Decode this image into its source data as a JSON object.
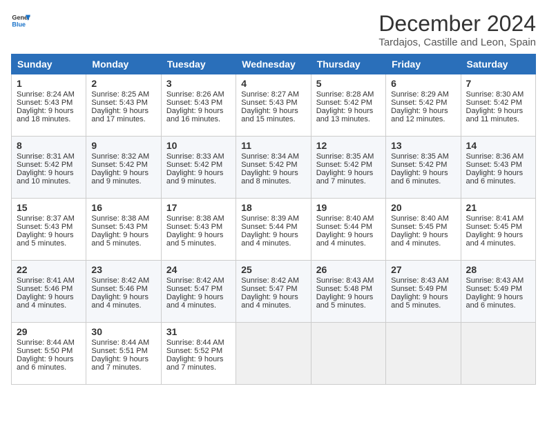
{
  "logo": {
    "line1": "General",
    "line2": "Blue"
  },
  "title": "December 2024",
  "location": "Tardajos, Castille and Leon, Spain",
  "headers": [
    "Sunday",
    "Monday",
    "Tuesday",
    "Wednesday",
    "Thursday",
    "Friday",
    "Saturday"
  ],
  "weeks": [
    [
      {
        "day": "1",
        "sunrise": "8:24 AM",
        "sunset": "5:43 PM",
        "daylight": "9 hours and 18 minutes."
      },
      {
        "day": "2",
        "sunrise": "8:25 AM",
        "sunset": "5:43 PM",
        "daylight": "9 hours and 17 minutes."
      },
      {
        "day": "3",
        "sunrise": "8:26 AM",
        "sunset": "5:43 PM",
        "daylight": "9 hours and 16 minutes."
      },
      {
        "day": "4",
        "sunrise": "8:27 AM",
        "sunset": "5:43 PM",
        "daylight": "9 hours and 15 minutes."
      },
      {
        "day": "5",
        "sunrise": "8:28 AM",
        "sunset": "5:42 PM",
        "daylight": "9 hours and 13 minutes."
      },
      {
        "day": "6",
        "sunrise": "8:29 AM",
        "sunset": "5:42 PM",
        "daylight": "9 hours and 12 minutes."
      },
      {
        "day": "7",
        "sunrise": "8:30 AM",
        "sunset": "5:42 PM",
        "daylight": "9 hours and 11 minutes."
      }
    ],
    [
      {
        "day": "8",
        "sunrise": "8:31 AM",
        "sunset": "5:42 PM",
        "daylight": "9 hours and 10 minutes."
      },
      {
        "day": "9",
        "sunrise": "8:32 AM",
        "sunset": "5:42 PM",
        "daylight": "9 hours and 9 minutes."
      },
      {
        "day": "10",
        "sunrise": "8:33 AM",
        "sunset": "5:42 PM",
        "daylight": "9 hours and 9 minutes."
      },
      {
        "day": "11",
        "sunrise": "8:34 AM",
        "sunset": "5:42 PM",
        "daylight": "9 hours and 8 minutes."
      },
      {
        "day": "12",
        "sunrise": "8:35 AM",
        "sunset": "5:42 PM",
        "daylight": "9 hours and 7 minutes."
      },
      {
        "day": "13",
        "sunrise": "8:35 AM",
        "sunset": "5:42 PM",
        "daylight": "9 hours and 6 minutes."
      },
      {
        "day": "14",
        "sunrise": "8:36 AM",
        "sunset": "5:43 PM",
        "daylight": "9 hours and 6 minutes."
      }
    ],
    [
      {
        "day": "15",
        "sunrise": "8:37 AM",
        "sunset": "5:43 PM",
        "daylight": "9 hours and 5 minutes."
      },
      {
        "day": "16",
        "sunrise": "8:38 AM",
        "sunset": "5:43 PM",
        "daylight": "9 hours and 5 minutes."
      },
      {
        "day": "17",
        "sunrise": "8:38 AM",
        "sunset": "5:43 PM",
        "daylight": "9 hours and 5 minutes."
      },
      {
        "day": "18",
        "sunrise": "8:39 AM",
        "sunset": "5:44 PM",
        "daylight": "9 hours and 4 minutes."
      },
      {
        "day": "19",
        "sunrise": "8:40 AM",
        "sunset": "5:44 PM",
        "daylight": "9 hours and 4 minutes."
      },
      {
        "day": "20",
        "sunrise": "8:40 AM",
        "sunset": "5:45 PM",
        "daylight": "9 hours and 4 minutes."
      },
      {
        "day": "21",
        "sunrise": "8:41 AM",
        "sunset": "5:45 PM",
        "daylight": "9 hours and 4 minutes."
      }
    ],
    [
      {
        "day": "22",
        "sunrise": "8:41 AM",
        "sunset": "5:46 PM",
        "daylight": "9 hours and 4 minutes."
      },
      {
        "day": "23",
        "sunrise": "8:42 AM",
        "sunset": "5:46 PM",
        "daylight": "9 hours and 4 minutes."
      },
      {
        "day": "24",
        "sunrise": "8:42 AM",
        "sunset": "5:47 PM",
        "daylight": "9 hours and 4 minutes."
      },
      {
        "day": "25",
        "sunrise": "8:42 AM",
        "sunset": "5:47 PM",
        "daylight": "9 hours and 4 minutes."
      },
      {
        "day": "26",
        "sunrise": "8:43 AM",
        "sunset": "5:48 PM",
        "daylight": "9 hours and 5 minutes."
      },
      {
        "day": "27",
        "sunrise": "8:43 AM",
        "sunset": "5:49 PM",
        "daylight": "9 hours and 5 minutes."
      },
      {
        "day": "28",
        "sunrise": "8:43 AM",
        "sunset": "5:49 PM",
        "daylight": "9 hours and 6 minutes."
      }
    ],
    [
      {
        "day": "29",
        "sunrise": "8:44 AM",
        "sunset": "5:50 PM",
        "daylight": "9 hours and 6 minutes."
      },
      {
        "day": "30",
        "sunrise": "8:44 AM",
        "sunset": "5:51 PM",
        "daylight": "9 hours and 7 minutes."
      },
      {
        "day": "31",
        "sunrise": "8:44 AM",
        "sunset": "5:52 PM",
        "daylight": "9 hours and 7 minutes."
      },
      null,
      null,
      null,
      null
    ]
  ],
  "labels": {
    "sunrise": "Sunrise:",
    "sunset": "Sunset:",
    "daylight": "Daylight:"
  }
}
